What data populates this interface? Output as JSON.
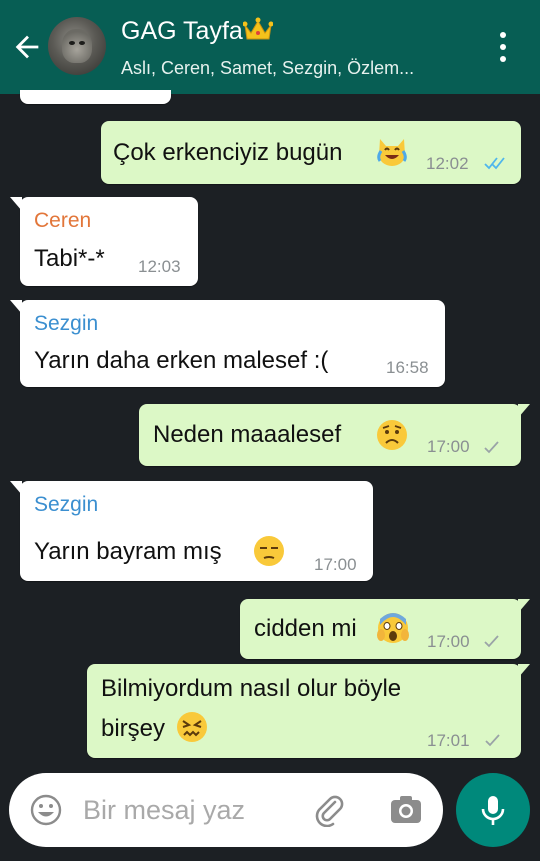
{
  "header": {
    "group_name": "GAG Tayfa",
    "members": "Aslı, Ceren, Samet, Sezgin, Özlem...",
    "back_icon": "arrow-left-icon",
    "menu_icon": "more-vert-icon",
    "crown_icon": "crown-emoji"
  },
  "messages": [
    {
      "direction": "out",
      "text": "Çok erkenciyiz bugün",
      "emoji": "cat-tears-of-joy",
      "time": "12:02",
      "status": "read"
    },
    {
      "direction": "in",
      "sender": "Ceren",
      "sender_color": "#e2763a",
      "text": "Tabi*-*",
      "time": "12:03"
    },
    {
      "direction": "in",
      "sender": "Sezgin",
      "sender_color": "#3b8fd0",
      "text": "Yarın daha erken malesef :(",
      "time": "16:58"
    },
    {
      "direction": "out",
      "text": "Neden maaalesef",
      "emoji": "worried-face",
      "time": "17:00",
      "status": "sent"
    },
    {
      "direction": "in",
      "sender": "Sezgin",
      "sender_color": "#3b8fd0",
      "text": "Yarın bayram mış",
      "emoji": "unamused-face",
      "time": "17:00"
    },
    {
      "direction": "out",
      "text": "cidden mi",
      "emoji": "screaming-face",
      "time": "17:00",
      "status": "sent"
    },
    {
      "direction": "out",
      "text_line1": "Bilmiyordum nasıl olur böyle",
      "text_line2": "birşey",
      "emoji": "confounded-face",
      "time": "17:01",
      "status": "sent"
    }
  ],
  "composer": {
    "placeholder": "Bir mesaj yaz",
    "emoji_icon": "emoji-smiley-icon",
    "attach_icon": "paperclip-icon",
    "camera_icon": "camera-icon",
    "mic_icon": "microphone-icon"
  },
  "colors": {
    "header": "#075e54",
    "outgoing_bubble": "#dcf8c6",
    "incoming_bubble": "#ffffff",
    "chat_background": "#1c2024",
    "read_tick": "#4fb6ec",
    "mic_button": "#00897b"
  }
}
